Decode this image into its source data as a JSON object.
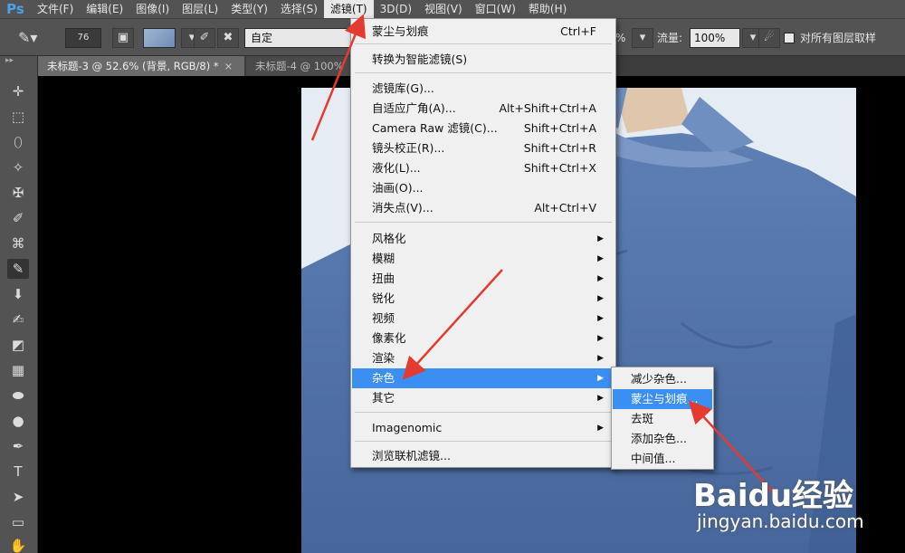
{
  "app": {
    "logo": "Ps"
  },
  "menubar": {
    "items": [
      "文件(F)",
      "编辑(E)",
      "图像(I)",
      "图层(L)",
      "类型(Y)",
      "选择(S)",
      "滤镜(T)",
      "3D(D)",
      "视图(V)",
      "窗口(W)",
      "帮助(H)"
    ],
    "active": "滤镜(T)"
  },
  "options": {
    "brush_size": "76",
    "mode": "自定",
    "opacity_partial": "%",
    "flow_label": "流量:",
    "flow_value": "100%",
    "sample_all_layers": "对所有图层取样"
  },
  "tabs": [
    {
      "label": "未标题-3 @ 52.6% (背景, RGB/8) *",
      "close": "×"
    },
    {
      "label": "未标题-4 @ 100%"
    }
  ],
  "filter_menu": {
    "items": [
      {
        "label": "蒙尘与划痕",
        "shortcut": "Ctrl+F"
      },
      {
        "label": "转换为智能滤镜(S)"
      },
      {
        "label": "滤镜库(G)..."
      },
      {
        "label": "自适应广角(A)...",
        "shortcut": "Alt+Shift+Ctrl+A"
      },
      {
        "label": "Camera Raw 滤镜(C)...",
        "shortcut": "Shift+Ctrl+A"
      },
      {
        "label": "镜头校正(R)...",
        "shortcut": "Shift+Ctrl+R"
      },
      {
        "label": "液化(L)...",
        "shortcut": "Shift+Ctrl+X"
      },
      {
        "label": "油画(O)..."
      },
      {
        "label": "消失点(V)...",
        "shortcut": "Alt+Ctrl+V"
      },
      {
        "label": "风格化"
      },
      {
        "label": "模糊"
      },
      {
        "label": "扭曲"
      },
      {
        "label": "锐化"
      },
      {
        "label": "视频"
      },
      {
        "label": "像素化"
      },
      {
        "label": "渲染"
      },
      {
        "label": "杂色"
      },
      {
        "label": "其它"
      },
      {
        "label": "Imagenomic"
      },
      {
        "label": "浏览联机滤镜..."
      }
    ],
    "highlighted": "杂色"
  },
  "noise_submenu": {
    "items": [
      "减少杂色...",
      "蒙尘与划痕...",
      "去斑",
      "添加杂色...",
      "中间值..."
    ],
    "highlighted": "蒙尘与划痕..."
  },
  "watermark": {
    "logo": "Baidu经验",
    "url": "jingyan.baidu.com"
  },
  "colors": {
    "menu_highlight": "#3b8ff2",
    "annotation_arrow": "#e53a2f",
    "ps_blue": "#4aa3e8"
  }
}
